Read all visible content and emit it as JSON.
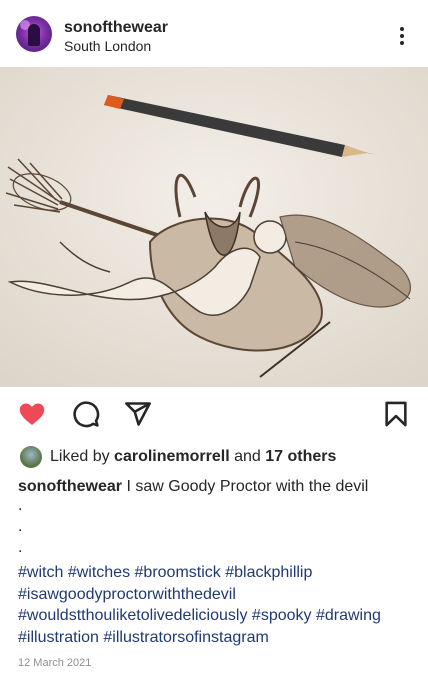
{
  "post": {
    "username": "sonofthewear",
    "location": "South London",
    "image_icon": "pencil-sketch-witch-on-broomstick-with-goat"
  },
  "actions": {
    "like_icon": "heart-icon",
    "comment_icon": "comment-icon",
    "share_icon": "send-icon",
    "save_icon": "bookmark-icon",
    "like_color": "#ed4956"
  },
  "likes": {
    "prefix": "Liked by",
    "user": "carolinemorrell",
    "and": "and",
    "others": "17 others"
  },
  "caption": {
    "username": "sonofthewear",
    "text": "I saw Goody Proctor with the devil",
    "dots": [
      ".",
      ".",
      "."
    ]
  },
  "hashtags": [
    [
      "#witch",
      "#witches",
      "#broomstick",
      "#blackphillip"
    ],
    [
      "#isawgoodyproctorwiththedevil"
    ],
    [
      "#wouldstthouliketolivedeliciously",
      "#spooky",
      "#drawing"
    ],
    [
      "#illustration",
      "#illustratorsofinstagram"
    ]
  ],
  "date": "12 March 2021",
  "colors": {
    "hashtag": "#1f3a72",
    "text": "#262626",
    "muted": "#8e8e8e"
  }
}
